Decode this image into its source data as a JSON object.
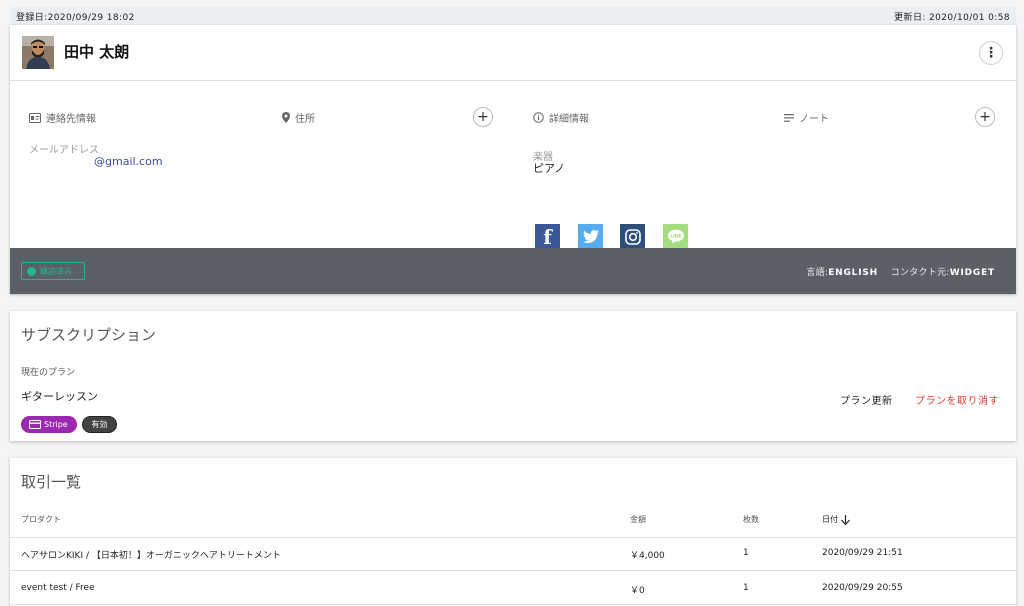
{
  "topbar": {
    "registered": "登録日:2020/09/29 18:02",
    "updated": "更新日: 2020/10/01 0:58"
  },
  "profile": {
    "name": "田中 太朗",
    "more_icon": "⋮"
  },
  "sections": {
    "contact": "連絡先情報",
    "address": "住所",
    "details": "詳細情報",
    "notes": "ノート",
    "plus": "+"
  },
  "contact": {
    "email_label": "メールアドレス",
    "email_value": "@gmail.com"
  },
  "details": {
    "instrument_label": "楽器",
    "instrument_value": "ピアノ"
  },
  "social": [
    {
      "name": "facebook",
      "color": "#3b5998",
      "glyph": "f"
    },
    {
      "name": "twitter",
      "color": "#55acee",
      "glyph": "t"
    },
    {
      "name": "instagram",
      "color": "#2d4f7a",
      "glyph": "◎"
    },
    {
      "name": "line",
      "color": "#a4dd7f",
      "glyph": "LINE"
    }
  ],
  "footer": {
    "status": "購読済み",
    "language_label": "言語:",
    "language_value": "ENGLISH",
    "contact_label": "コンタクト元:",
    "contact_value": "WIDGET"
  },
  "subscription": {
    "title": "サブスクリプション",
    "current_plan_label": "現在のプラン",
    "plan_name": "ギターレッスン",
    "update_button": "プラン更新",
    "cancel_button": "プランを取り消す",
    "cancel_color": "#e53935",
    "stripe_chip": "Stripe",
    "stripe_color": "#9c27b0",
    "status_chip": "有効"
  },
  "transactions": {
    "title": "取引一覧",
    "headers": {
      "product": "プロダクト",
      "amount": "金額",
      "quantity": "枚数",
      "date": "日付"
    },
    "rows": [
      {
        "product": "ヘアサロンKIKI / 【日本初！】オーガニックヘアトリートメント",
        "amount": "￥4,000",
        "quantity": "1",
        "date": "2020/09/29 21:51"
      },
      {
        "product": "event test / Free",
        "amount": "￥0",
        "quantity": "1",
        "date": "2020/09/29 20:55"
      }
    ]
  }
}
